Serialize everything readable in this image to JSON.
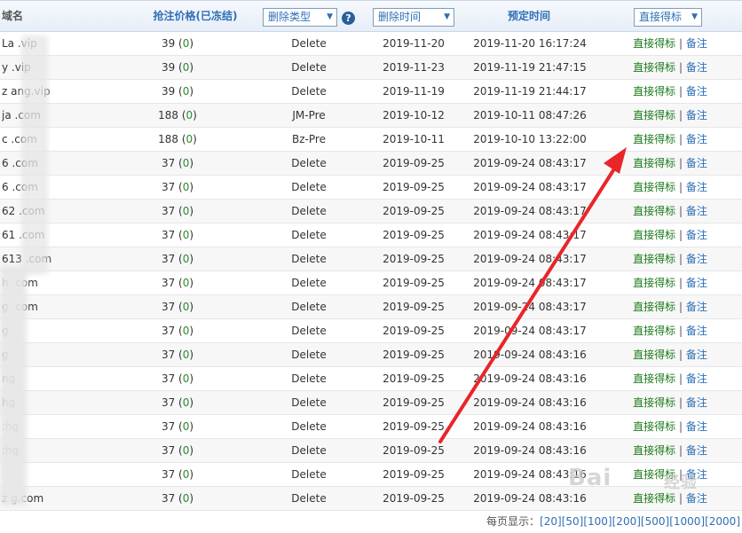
{
  "header": {
    "domain": "域名",
    "price": "抢注价格(已冻结)",
    "delete_type": "删除类型",
    "delete_time": "删除时间",
    "scheduled_time": "预定时间",
    "action": "直接得标"
  },
  "rows": [
    {
      "domain": "La      .vip",
      "price": "39",
      "frozen": "0",
      "type": "Delete",
      "date": "2019-11-20",
      "sched": "2019-11-20 16:17:24",
      "act1": "直接得标",
      "act2": "备注"
    },
    {
      "domain": "y       .vip",
      "price": "39",
      "frozen": "0",
      "type": "Delete",
      "date": "2019-11-23",
      "sched": "2019-11-19 21:47:15",
      "act1": "直接得标",
      "act2": "备注"
    },
    {
      "domain": "z      ang.vip",
      "price": "39",
      "frozen": "0",
      "type": "Delete",
      "date": "2019-11-19",
      "sched": "2019-11-19 21:44:17",
      "act1": "直接得标",
      "act2": "备注"
    },
    {
      "domain": "ja      .com",
      "price": "188",
      "frozen": "0",
      "type": "JM-Pre",
      "date": "2019-10-12",
      "sched": "2019-10-11 08:47:26",
      "act1": "直接得标",
      "act2": "备注"
    },
    {
      "domain": "c       .com",
      "price": "188",
      "frozen": "0",
      "type": "Bz-Pre",
      "date": "2019-10-11",
      "sched": "2019-10-10 13:22:00",
      "act1": "直接得标",
      "act2": "备注"
    },
    {
      "domain": "6       .com",
      "price": "37",
      "frozen": "0",
      "type": "Delete",
      "date": "2019-09-25",
      "sched": "2019-09-24 08:43:17",
      "act1": "直接得标",
      "act2": "备注"
    },
    {
      "domain": "6       .com",
      "price": "37",
      "frozen": "0",
      "type": "Delete",
      "date": "2019-09-25",
      "sched": "2019-09-24 08:43:17",
      "act1": "直接得标",
      "act2": "备注"
    },
    {
      "domain": "62      .com",
      "price": "37",
      "frozen": "0",
      "type": "Delete",
      "date": "2019-09-25",
      "sched": "2019-09-24 08:43:17",
      "act1": "直接得标",
      "act2": "备注"
    },
    {
      "domain": "61      .com",
      "price": "37",
      "frozen": "0",
      "type": "Delete",
      "date": "2019-09-25",
      "sched": "2019-09-24 08:43:17",
      "act1": "直接得标",
      "act2": "备注"
    },
    {
      "domain": "613     .com",
      "price": "37",
      "frozen": "0",
      "type": "Delete",
      "date": "2019-09-25",
      "sched": "2019-09-24 08:43:17",
      "act1": "直接得标",
      "act2": "备注"
    },
    {
      "domain": "      h   .com",
      "price": "37",
      "frozen": "0",
      "type": "Delete",
      "date": "2019-09-25",
      "sched": "2019-09-24 08:43:17",
      "act1": "直接得标",
      "act2": "备注"
    },
    {
      "domain": "     g    .com",
      "price": "37",
      "frozen": "0",
      "type": "Delete",
      "date": "2019-09-25",
      "sched": "2019-09-24 08:43:17",
      "act1": "直接得标",
      "act2": "备注"
    },
    {
      "domain": "     g",
      "price": "37",
      "frozen": "0",
      "type": "Delete",
      "date": "2019-09-25",
      "sched": "2019-09-24 08:43:17",
      "act1": "直接得标",
      "act2": "备注"
    },
    {
      "domain": "     g",
      "price": "37",
      "frozen": "0",
      "type": "Delete",
      "date": "2019-09-25",
      "sched": "2019-09-24 08:43:16",
      "act1": "直接得标",
      "act2": "备注"
    },
    {
      "domain": "    ng",
      "price": "37",
      "frozen": "0",
      "type": "Delete",
      "date": "2019-09-25",
      "sched": "2019-09-24 08:43:16",
      "act1": "直接得标",
      "act2": "备注"
    },
    {
      "domain": "    hg",
      "price": "37",
      "frozen": "0",
      "type": "Delete",
      "date": "2019-09-25",
      "sched": "2019-09-24 08:43:16",
      "act1": "直接得标",
      "act2": "备注"
    },
    {
      "domain": "   :hg",
      "price": "37",
      "frozen": "0",
      "type": "Delete",
      "date": "2019-09-25",
      "sched": "2019-09-24 08:43:16",
      "act1": "直接得标",
      "act2": "备注"
    },
    {
      "domain": "   :hg",
      "price": "37",
      "frozen": "0",
      "type": "Delete",
      "date": "2019-09-25",
      "sched": "2019-09-24 08:43:16",
      "act1": "直接得标",
      "act2": "备注"
    },
    {
      "domain": "",
      "price": "37",
      "frozen": "0",
      "type": "Delete",
      "date": "2019-09-25",
      "sched": "2019-09-24 08:43:16",
      "act1": "直接得标",
      "act2": "备注"
    },
    {
      "domain": "z     g.com",
      "price": "37",
      "frozen": "0",
      "type": "Delete",
      "date": "2019-09-25",
      "sched": "2019-09-24 08:43:16",
      "act1": "直接得标",
      "act2": "备注"
    }
  ],
  "pager": {
    "label": "每页显示：",
    "options": [
      "[20]",
      "[50]",
      "[100]",
      "[200]",
      "[500]",
      "[1000]",
      "[2000]"
    ]
  },
  "watermark": {
    "text": "Bai",
    "sub": "经验"
  },
  "colors": {
    "header_link": "#2f6fb6",
    "frozen_green": "#2a8a2a",
    "action_green": "#1b7a1b",
    "arrow_red": "#e8262a"
  }
}
